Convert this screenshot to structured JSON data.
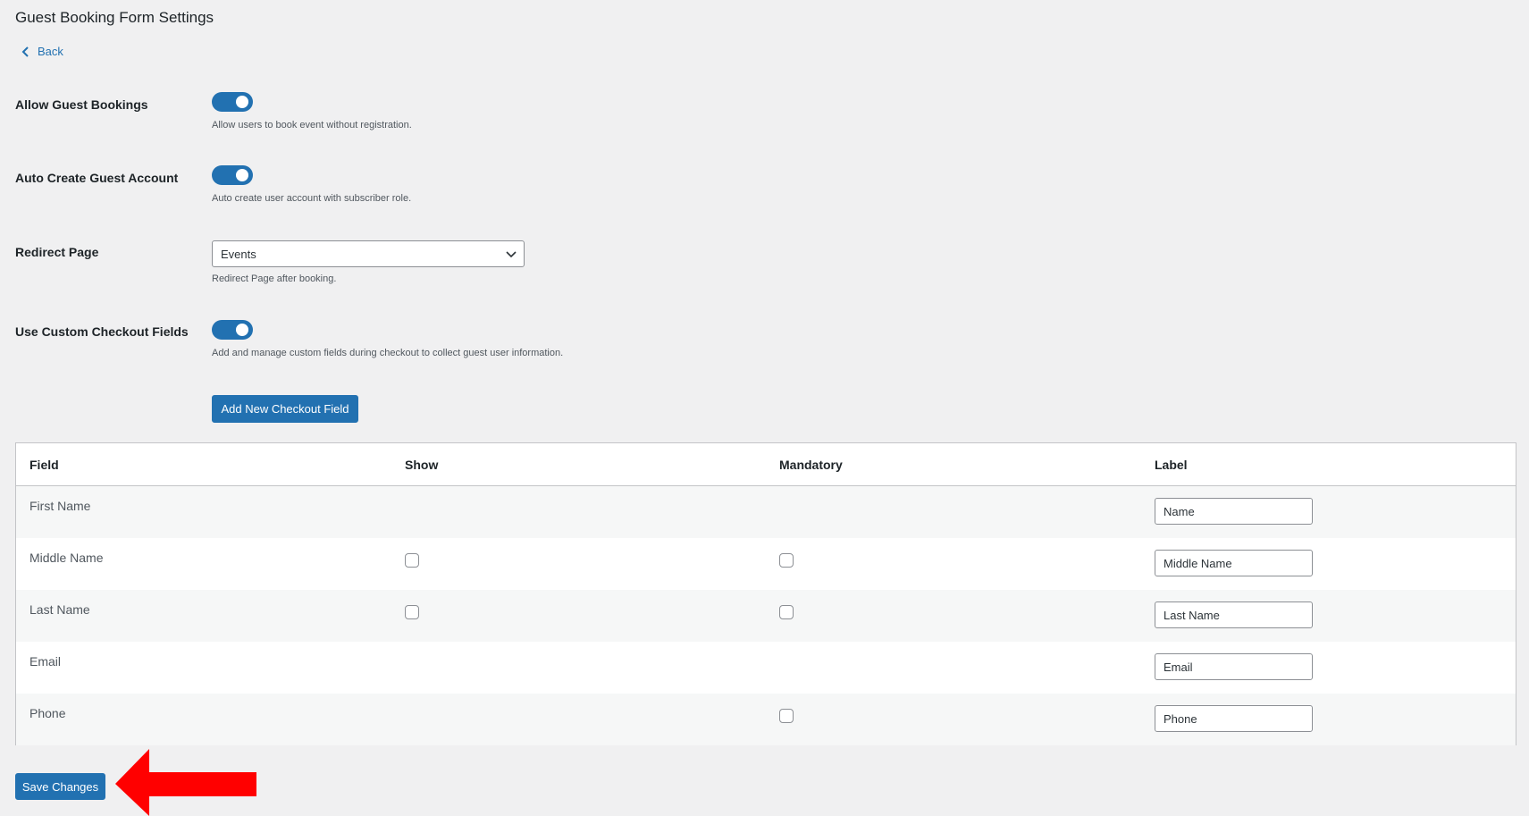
{
  "header": {
    "title": "Guest Booking Form Settings",
    "back_label": "Back"
  },
  "settings": {
    "allow_guest": {
      "label": "Allow Guest Bookings",
      "enabled": true,
      "desc": "Allow users to book event without registration."
    },
    "auto_create": {
      "label": "Auto Create Guest Account",
      "enabled": true,
      "desc": "Auto create user account with subscriber role."
    },
    "redirect": {
      "label": "Redirect Page",
      "selected": "Events",
      "desc": "Redirect Page after booking."
    },
    "custom_fields": {
      "label": "Use Custom Checkout Fields",
      "enabled": true,
      "desc": "Add and manage custom fields during checkout to collect guest user information."
    }
  },
  "add_button": "Add New Checkout Field",
  "table": {
    "headers": {
      "field": "Field",
      "show": "Show",
      "mandatory": "Mandatory",
      "label": "Label"
    },
    "rows": [
      {
        "field": "First Name",
        "show": null,
        "mandatory": null,
        "label": "Name"
      },
      {
        "field": "Middle Name",
        "show": false,
        "mandatory": false,
        "label": "Middle Name"
      },
      {
        "field": "Last Name",
        "show": false,
        "mandatory": false,
        "label": "Last Name"
      },
      {
        "field": "Email",
        "show": null,
        "mandatory": null,
        "label": "Email"
      },
      {
        "field": "Phone",
        "show": null,
        "mandatory": false,
        "label": "Phone"
      }
    ]
  },
  "save_button": "Save Changes",
  "colors": {
    "accent": "#2271b1",
    "background": "#f0f0f1",
    "annotation_arrow": "#ff0000"
  },
  "icons": {
    "back": "chevron-left-icon",
    "select": "chevron-down-icon",
    "annotation": "red-arrow-icon"
  }
}
